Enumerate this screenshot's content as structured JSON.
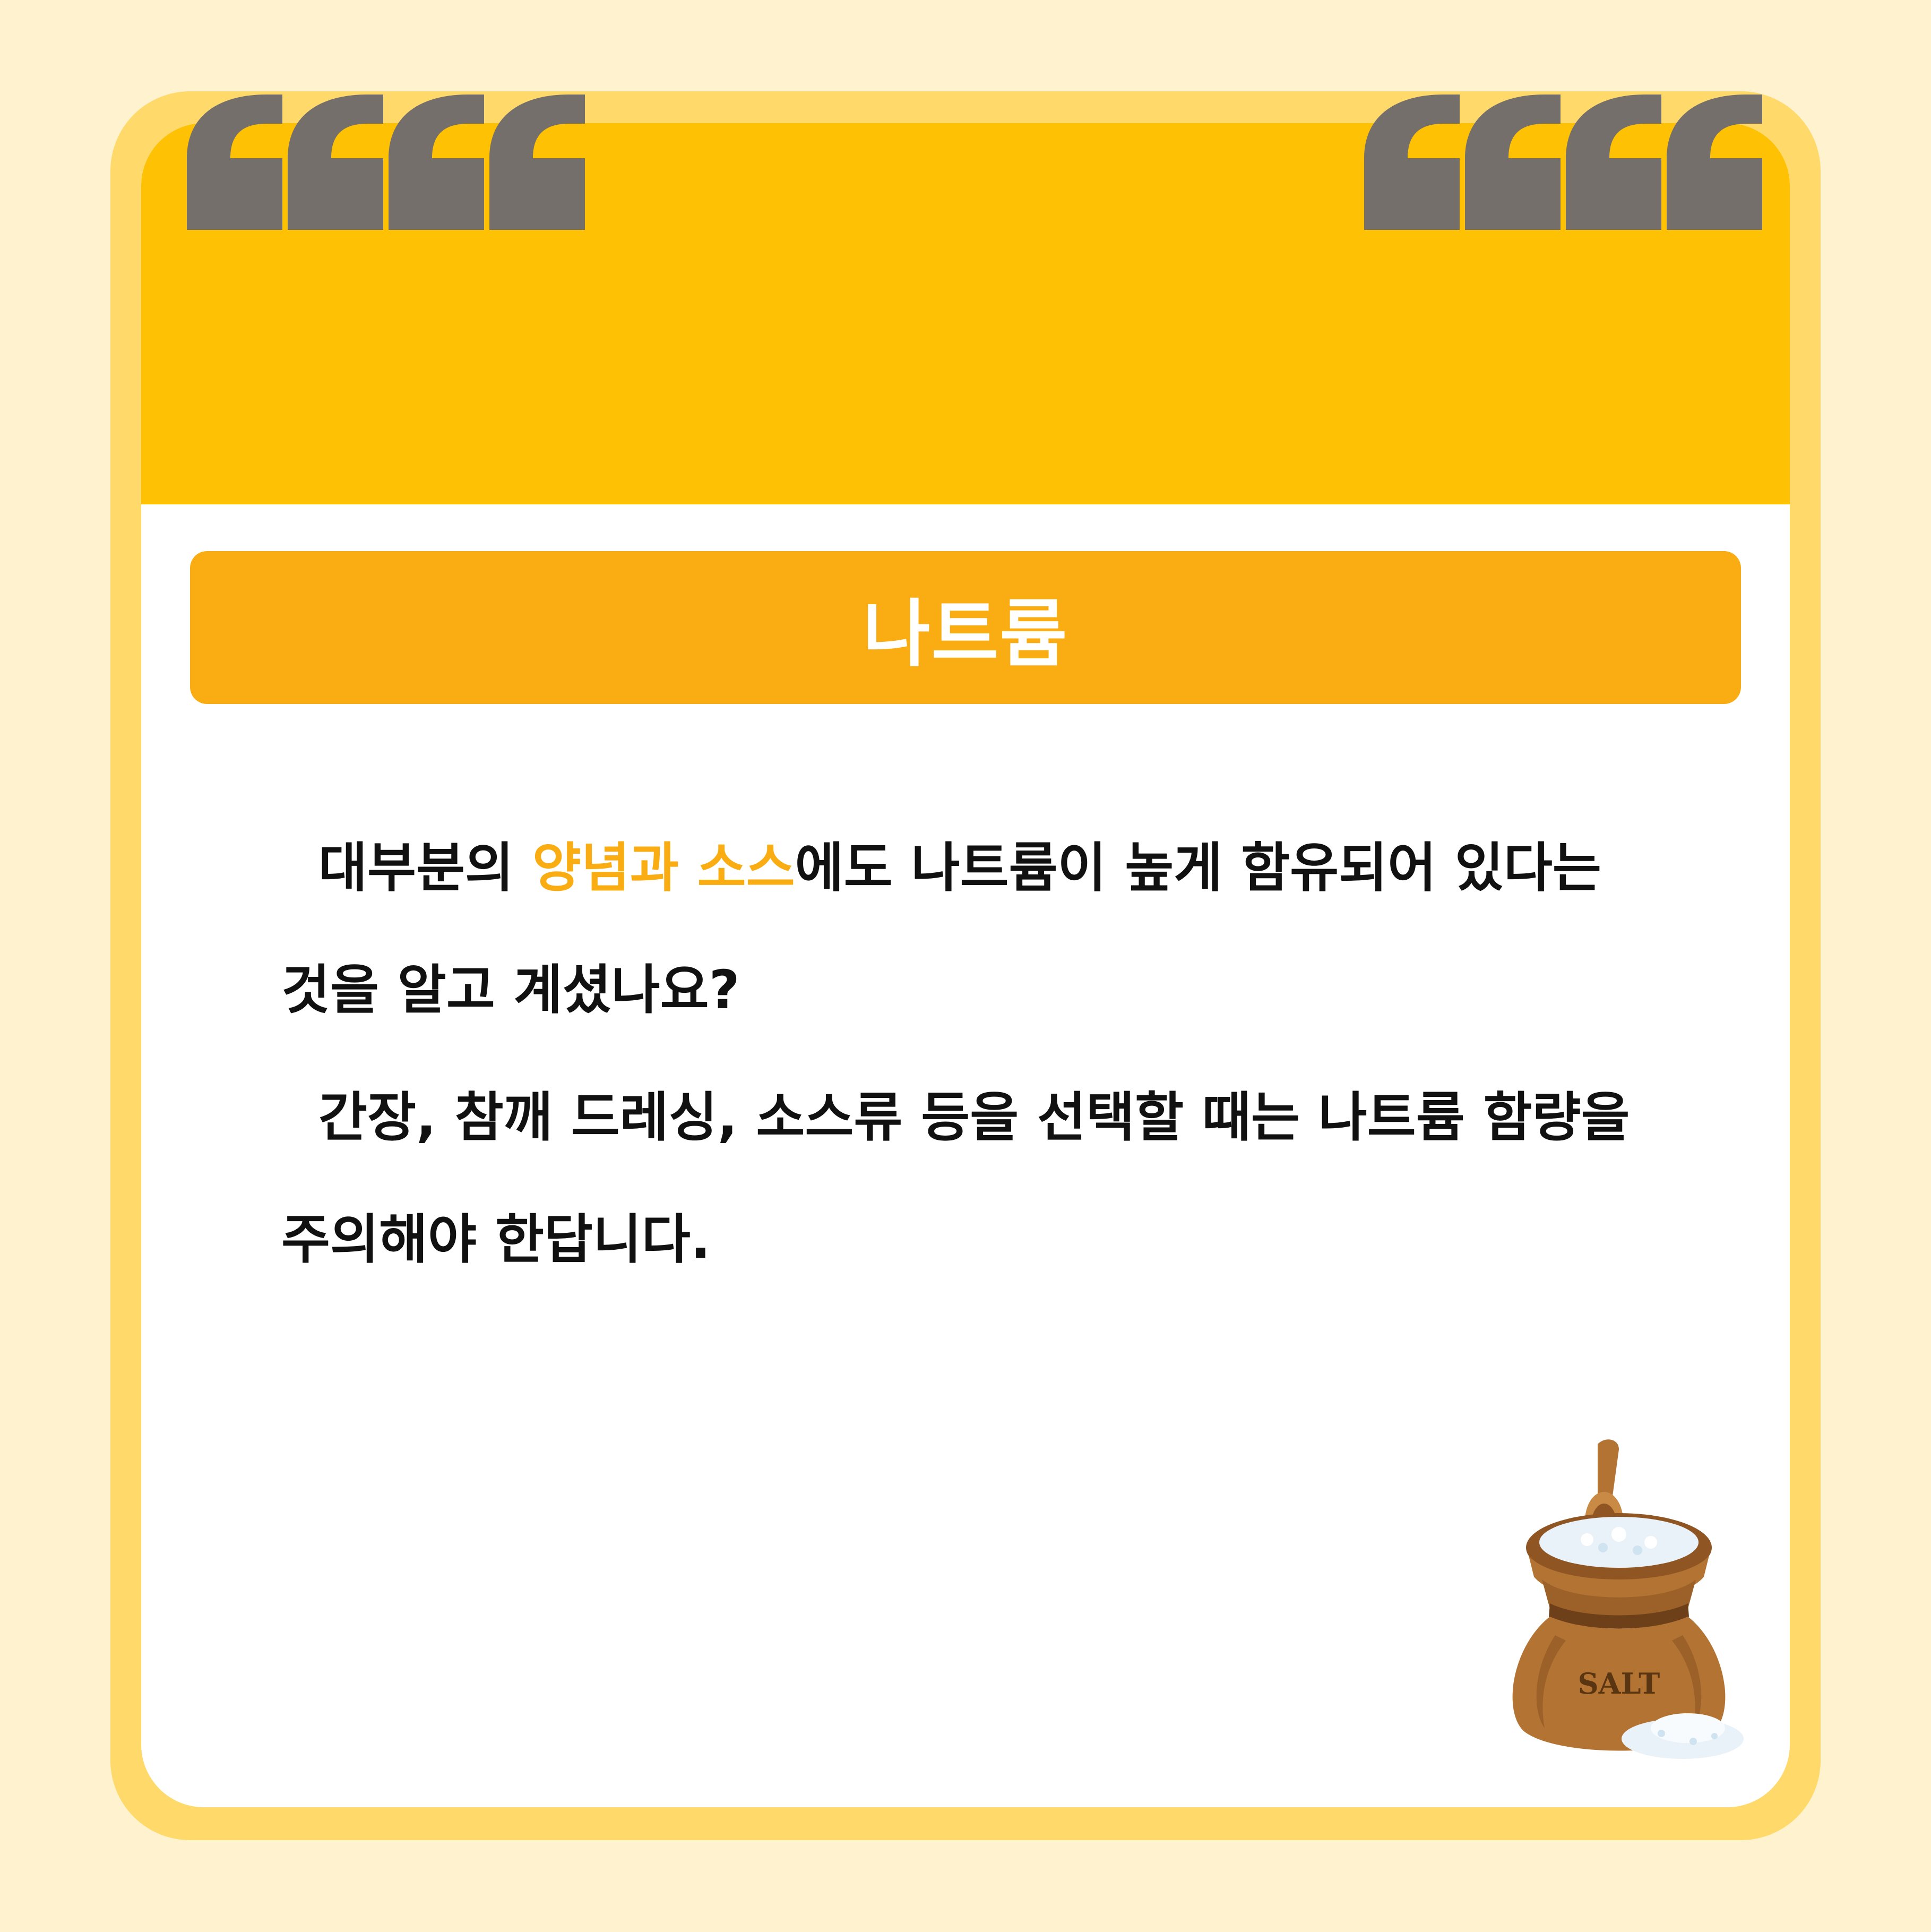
{
  "card": {
    "title": "나트륨",
    "paragraph1": {
      "before": "대부분의 ",
      "highlight": "양념과 소스",
      "after": "에도 나트륨이 높게 함유되어 있다는 것을 알고 계셨나요?"
    },
    "paragraph2": "간장, 참깨 드레싱, 소스류 등을 선택할 때는 나트륨 함량을 주의해야 한답니다."
  },
  "illustration": {
    "icon": "salt-sack-icon",
    "label": "SALT"
  },
  "colors": {
    "background": "#FFF2CE",
    "frame": "#FFD969",
    "header": "#FEC104",
    "title_bar": "#F9AD13",
    "accent": "#F9AD13",
    "quote_marks": "#756F6C"
  }
}
